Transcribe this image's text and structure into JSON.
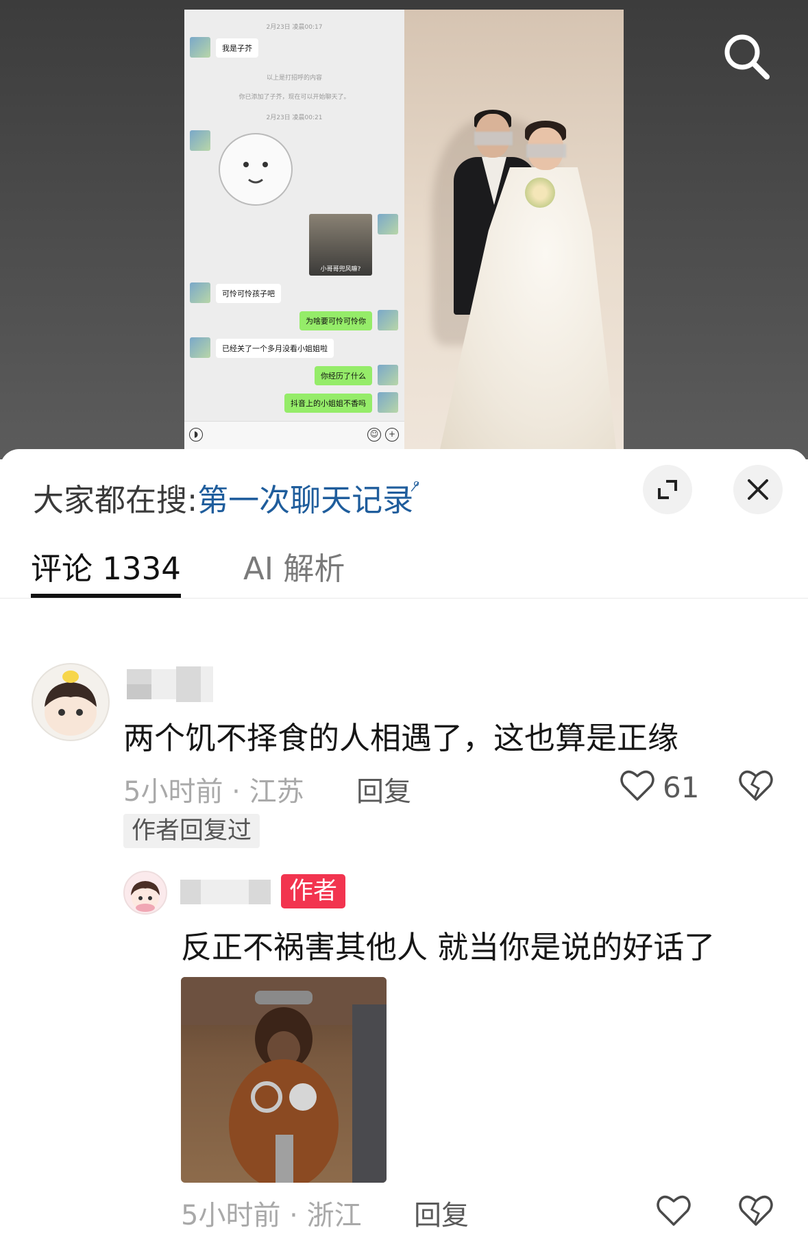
{
  "video": {
    "chat": {
      "timestamp1": "2月23日 凌晨00:17",
      "msg1": "我是子芥",
      "system1": "以上是打招呼的内容",
      "system2": "你已添加了子芥，现在可以开始聊天了。",
      "timestamp2": "2月23日 凌晨00:21",
      "image_caption": "小哥哥兜风嘛?",
      "msg2": "可怜可怜孩子吧",
      "msg3": "为啥要可怜可怜你",
      "msg4": "已经关了一个多月没看小姐姐啦",
      "msg5": "你经历了什么",
      "msg6": "抖音上的小姐姐不香吗"
    }
  },
  "sheet": {
    "hot_search_label": "大家都在搜:",
    "hot_search_keyword": "第一次聊天记录",
    "tabs": [
      {
        "label": "评论 1334",
        "active": true
      },
      {
        "label": "AI 解析",
        "active": false
      }
    ]
  },
  "comments": [
    {
      "text": "两个饥不择食的人相遇了，这也算是正缘",
      "time": "5小时前",
      "location": "江苏",
      "meta": "5小时前 · 江苏",
      "reply_label": "回复",
      "likes": "61",
      "author_replied_label": "作者回复过",
      "reply": {
        "badge": "作者",
        "text": "反正不祸害其他人 就当你是说的好话了",
        "time": "5小时前",
        "location": "浙江",
        "meta": "5小时前 · 浙江",
        "reply_label": "回复"
      }
    }
  ],
  "colors": {
    "hot_keyword": "#1f5d9c",
    "author_badge": "#f2344f",
    "chat_bubble_right": "#95ec69"
  },
  "icons": [
    "search-icon",
    "expand-icon",
    "close-icon",
    "heart-icon",
    "dislike-icon"
  ]
}
